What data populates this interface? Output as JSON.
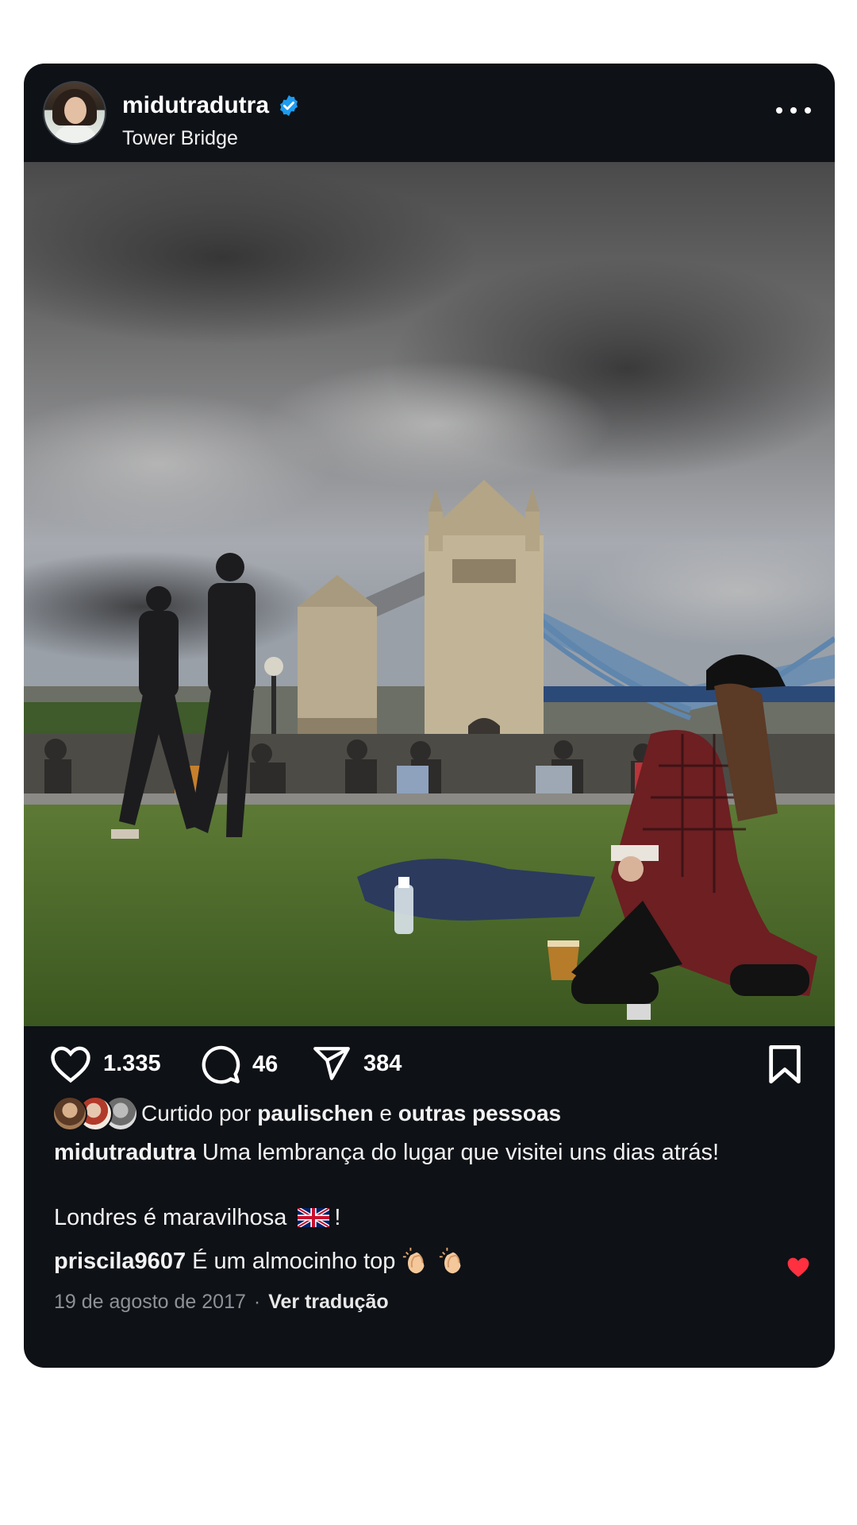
{
  "post": {
    "username": "midutradutra",
    "location": "Tower Bridge",
    "verified": true,
    "likes": "1.335",
    "comments": "46",
    "shares": "384",
    "liked_by_prefix": "Curtido por",
    "liked_by_user": "paulischen",
    "liked_by_and": "e",
    "liked_by_others": "outras pessoas",
    "caption_user": "midutradutra",
    "caption_text": "Uma lembrança do lugar que visitei uns dias atrás!",
    "caption_line2": "Londres é maravilhosa",
    "caption_line2_end": "!",
    "comment_user": "priscila9607",
    "comment_text": "É um almocinho top",
    "date": "19 de agosto de 2017",
    "separator": "·",
    "translate_label": "Ver tradução"
  },
  "icons": {
    "verified": "verified-badge-icon",
    "more": "more-options-icon",
    "like": "heart-icon",
    "comment": "comment-bubble-icon",
    "share": "paper-plane-icon",
    "save": "bookmark-icon",
    "flag": "uk-flag-icon",
    "clap": "clapping-hands-icon",
    "comment_like": "heart-filled-icon"
  },
  "colors": {
    "card_bg": "#0e1116",
    "verified_blue": "#1d9bf0",
    "heart_red": "#ff3040",
    "meta_gray": "#8e9196"
  }
}
